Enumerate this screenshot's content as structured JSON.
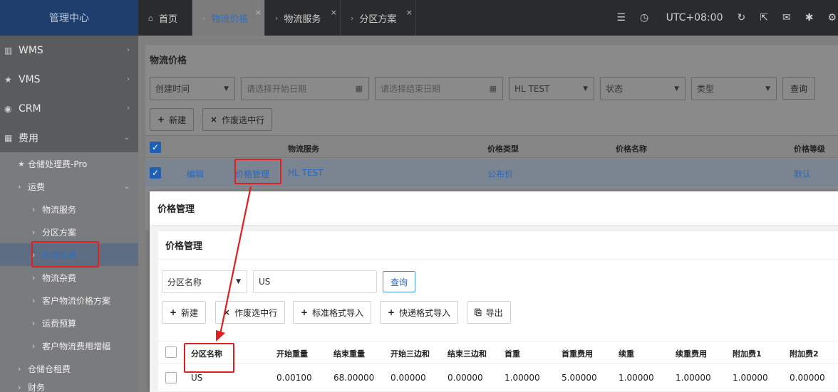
{
  "sidebar": {
    "brand": "管理中心",
    "menus": [
      {
        "icon": "bank-icon",
        "glyph": "▥",
        "label": "WMS"
      },
      {
        "icon": "star-icon",
        "glyph": "★",
        "label": "VMS"
      },
      {
        "icon": "user-icon",
        "glyph": "◉",
        "label": "CRM"
      },
      {
        "icon": "grid-icon",
        "glyph": "▦",
        "label": "费用"
      }
    ],
    "sub": {
      "storage_fee": "仓储处理费-Pro",
      "freight": "运费",
      "items": [
        "物流服务",
        "分区方案",
        "物流价格",
        "物流杂费",
        "客户物流价格方案",
        "运费预算",
        "客户物流费用增幅"
      ],
      "warehouse_rent": "仓储仓租费",
      "bottom_cut": "财务"
    }
  },
  "topbar": {
    "tabs": [
      {
        "label": "首页",
        "symbol": "⌂"
      },
      {
        "label": "物流价格",
        "symbol": "›"
      },
      {
        "label": "物流服务",
        "symbol": "›"
      },
      {
        "label": "分区方案",
        "symbol": "›"
      }
    ],
    "timezone": "UTC+08:00"
  },
  "page": {
    "title": "物流价格",
    "filters": {
      "time_select": "创建时间",
      "start_placeholder": "请选择开始日期",
      "end_placeholder": "请选择结束日期",
      "service": "HL TEST",
      "status": "状态",
      "type": "类型",
      "query": "查询"
    },
    "actions": {
      "new": "新建",
      "void": "作废选中行"
    },
    "columns": [
      "物流服务",
      "价格类型",
      "价格名称",
      "价格等级"
    ],
    "row": {
      "edit": "编辑",
      "manage": "价格管理",
      "service": "HL TEST",
      "price_type": "公布价",
      "level": "默认"
    }
  },
  "modal": {
    "title": "价格管理",
    "inner_title": "价格管理",
    "search_field": "分区名称",
    "search_value": "US",
    "query": "查询",
    "actions": {
      "new": "新建",
      "void": "作废选中行",
      "std_import": "标准格式导入",
      "express_import": "快递格式导入",
      "export": "导出"
    },
    "columns": [
      "分区名称",
      "开始重量",
      "结束重量",
      "开始三边和",
      "结束三边和",
      "首重",
      "首重费用",
      "续重",
      "续重费用",
      "附加费1",
      "附加费2"
    ],
    "row": [
      "US",
      "0.00100",
      "68.00000",
      "0.00000",
      "0.00000",
      "1.00000",
      "5.00000",
      "1.00000",
      "1.00000",
      "1.00000",
      "0.00000"
    ]
  },
  "colors": {
    "accent": "#2a66bd",
    "highlight": "#e02020",
    "brand_bg": "#1e3f6e"
  }
}
